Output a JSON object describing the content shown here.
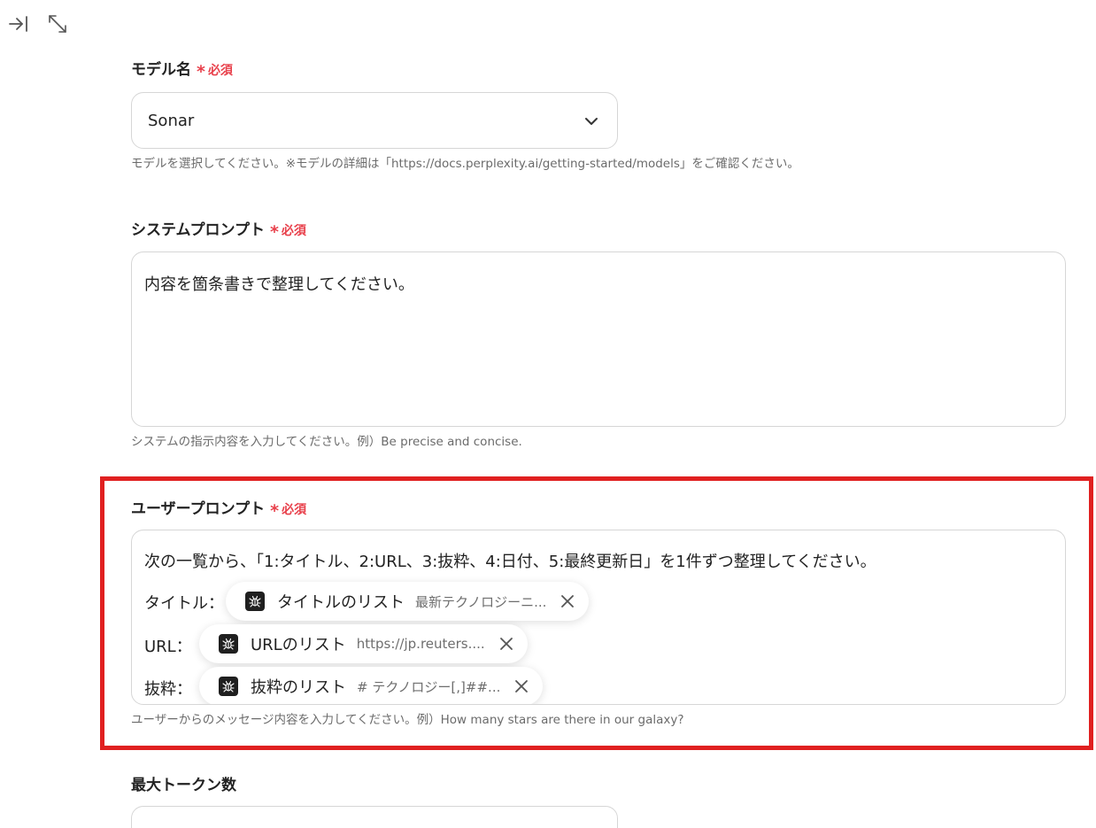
{
  "toolbar": {
    "collapse_icon": "collapse-right-icon",
    "expand_icon": "expand-diagonal-icon"
  },
  "accent_color": "#e8404b",
  "highlight_color": "#e02020",
  "required_marker": "必須",
  "model": {
    "label": "モデル名",
    "value": "Sonar",
    "help": "モデルを選択してください。※モデルの詳細は「https://docs.perplexity.ai/getting-started/models」をご確認ください。"
  },
  "system_prompt": {
    "label": "システムプロンプト",
    "value": "内容を箇条書きで整理してください。",
    "help": "システムの指示内容を入力してください。例）Be precise and concise."
  },
  "user_prompt": {
    "label": "ユーザープロンプト",
    "first_line": "次の一覧から、「1:タイトル、2:URL、3:抜粋、4:日付、5:最終更新日」を1件ずつ整理してください。",
    "rows": [
      {
        "prefix": "タイトル：",
        "chip_name": "タイトルのリスト",
        "chip_preview": "最新テクノロジーニ..."
      },
      {
        "prefix": "URL：",
        "chip_name": "URLのリスト",
        "chip_preview": "https://jp.reuters...."
      },
      {
        "prefix": "抜粋：",
        "chip_name": "抜粋のリスト",
        "chip_preview": "# テクノロジー[,]##..."
      }
    ],
    "help": "ユーザーからのメッセージ内容を入力してください。例）How many stars are there in our galaxy?"
  },
  "max_tokens": {
    "label": "最大トークン数"
  }
}
